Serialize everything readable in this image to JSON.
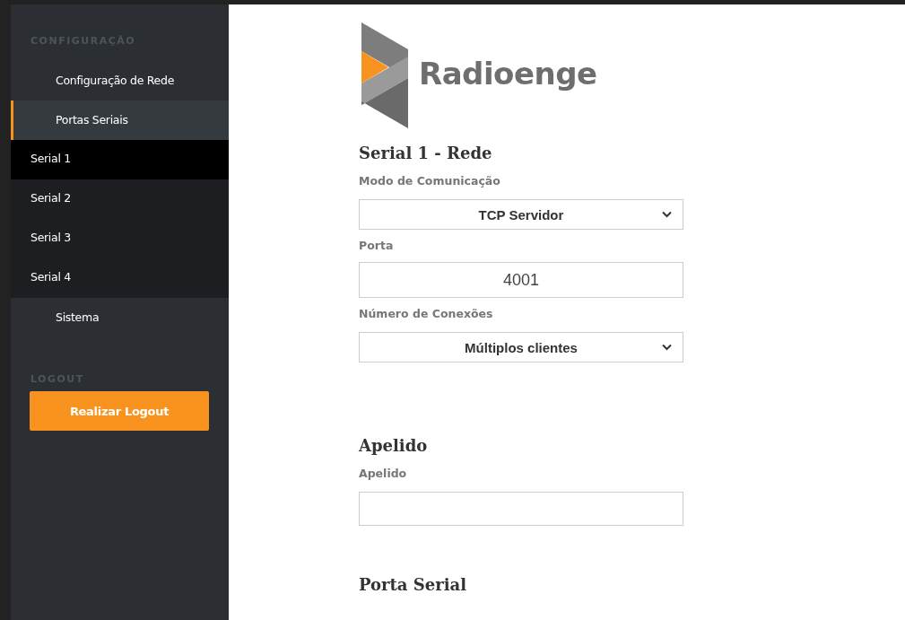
{
  "sidebar": {
    "groups": [
      {
        "title": "CONFIGURAÇÃO",
        "items": [
          {
            "label": "Configuração de Rede",
            "selected": false
          },
          {
            "label": "Portas Seriais",
            "selected": true,
            "children": [
              {
                "label": "Serial 1",
                "selected": true
              },
              {
                "label": "Serial 2",
                "selected": false
              },
              {
                "label": "Serial 3",
                "selected": false
              },
              {
                "label": "Serial 4",
                "selected": false
              }
            ]
          },
          {
            "label": "Sistema",
            "selected": false
          }
        ]
      },
      {
        "title": "LOGOUT",
        "button": "Realizar Logout"
      }
    ]
  },
  "logo": {
    "name": "Radioenge"
  },
  "sections": [
    {
      "title": "Serial 1 - Rede",
      "fields": [
        {
          "label": "Modo de Comunicação",
          "kind": "select",
          "value": "TCP Servidor"
        },
        {
          "label": "Porta",
          "kind": "text",
          "value": "4001"
        },
        {
          "label": "Número de Conexões",
          "kind": "select",
          "value": "Múltiplos clientes"
        }
      ]
    },
    {
      "title": "Apelido",
      "fields": [
        {
          "label": "Apelido",
          "kind": "text"
        }
      ]
    },
    {
      "title": "Porta Serial"
    }
  ]
}
